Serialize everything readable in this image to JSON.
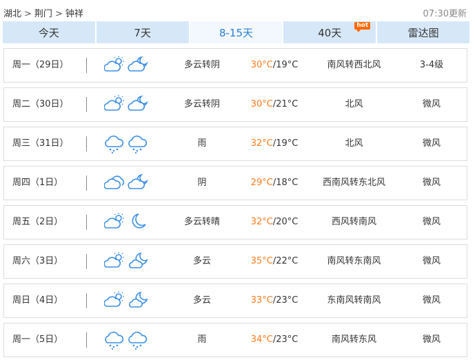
{
  "breadcrumb": {
    "province": "湖北",
    "city": "荆门",
    "district": "钟祥",
    "separator": ">"
  },
  "update_time": "07:30更新",
  "tabs": [
    {
      "label": "今天",
      "active": false
    },
    {
      "label": "7天",
      "active": false
    },
    {
      "label": "8-15天",
      "active": true
    },
    {
      "label": "40天",
      "active": false,
      "badge": "hot"
    },
    {
      "label": "雷达图",
      "active": false
    }
  ],
  "days": [
    {
      "day": "周一（29日）",
      "icons": [
        "cloudy-sun-icon",
        "cloudy-moon-icon"
      ],
      "desc": "多云转阴",
      "high": "30°C",
      "low": "/19°C",
      "wind": "南风转西北风",
      "level": "3-4级"
    },
    {
      "day": "周二（30日）",
      "icons": [
        "cloudy-sun-icon",
        "cloudy-moon-icon"
      ],
      "desc": "多云转阴",
      "high": "30°C",
      "low": "/21°C",
      "wind": "北风",
      "level": "微风"
    },
    {
      "day": "周三（31日）",
      "icons": [
        "rain-icon",
        "rain-icon"
      ],
      "desc": "雨",
      "high": "32°C",
      "low": "/19°C",
      "wind": "北风",
      "level": "微风"
    },
    {
      "day": "周四（1日）",
      "icons": [
        "overcast-icon",
        "cloudy-moon-icon"
      ],
      "desc": "阴",
      "high": "29°C",
      "low": "/18°C",
      "wind": "西南风转东北风",
      "level": "微风"
    },
    {
      "day": "周五（2日）",
      "icons": [
        "cloudy-sun-icon",
        "moon-icon"
      ],
      "desc": "多云转晴",
      "high": "32°C",
      "low": "/20°C",
      "wind": "西风转南风",
      "level": "微风"
    },
    {
      "day": "周六（3日）",
      "icons": [
        "cloudy-sun-icon",
        "partly-cloudy-moon-icon"
      ],
      "desc": "多云",
      "high": "35°C",
      "low": "/22°C",
      "wind": "南风转东南风",
      "level": "微风"
    },
    {
      "day": "周日（4日）",
      "icons": [
        "cloudy-sun-icon",
        "partly-cloudy-moon-icon"
      ],
      "desc": "多云",
      "high": "33°C",
      "low": "/23°C",
      "wind": "东南风转南风",
      "level": "微风"
    },
    {
      "day": "周一（5日）",
      "icons": [
        "rain-icon",
        "rain-icon"
      ],
      "desc": "雨",
      "high": "34°C",
      "low": "/23°C",
      "wind": "南风转东风",
      "level": "微风"
    }
  ],
  "colors": {
    "accent": "#2a7fd4",
    "high_temp": "#ff7a1a",
    "icon_stroke": "#3a8ee6",
    "tab_bg": "#d6e8f8",
    "hot_badge": "#ff6a00"
  }
}
